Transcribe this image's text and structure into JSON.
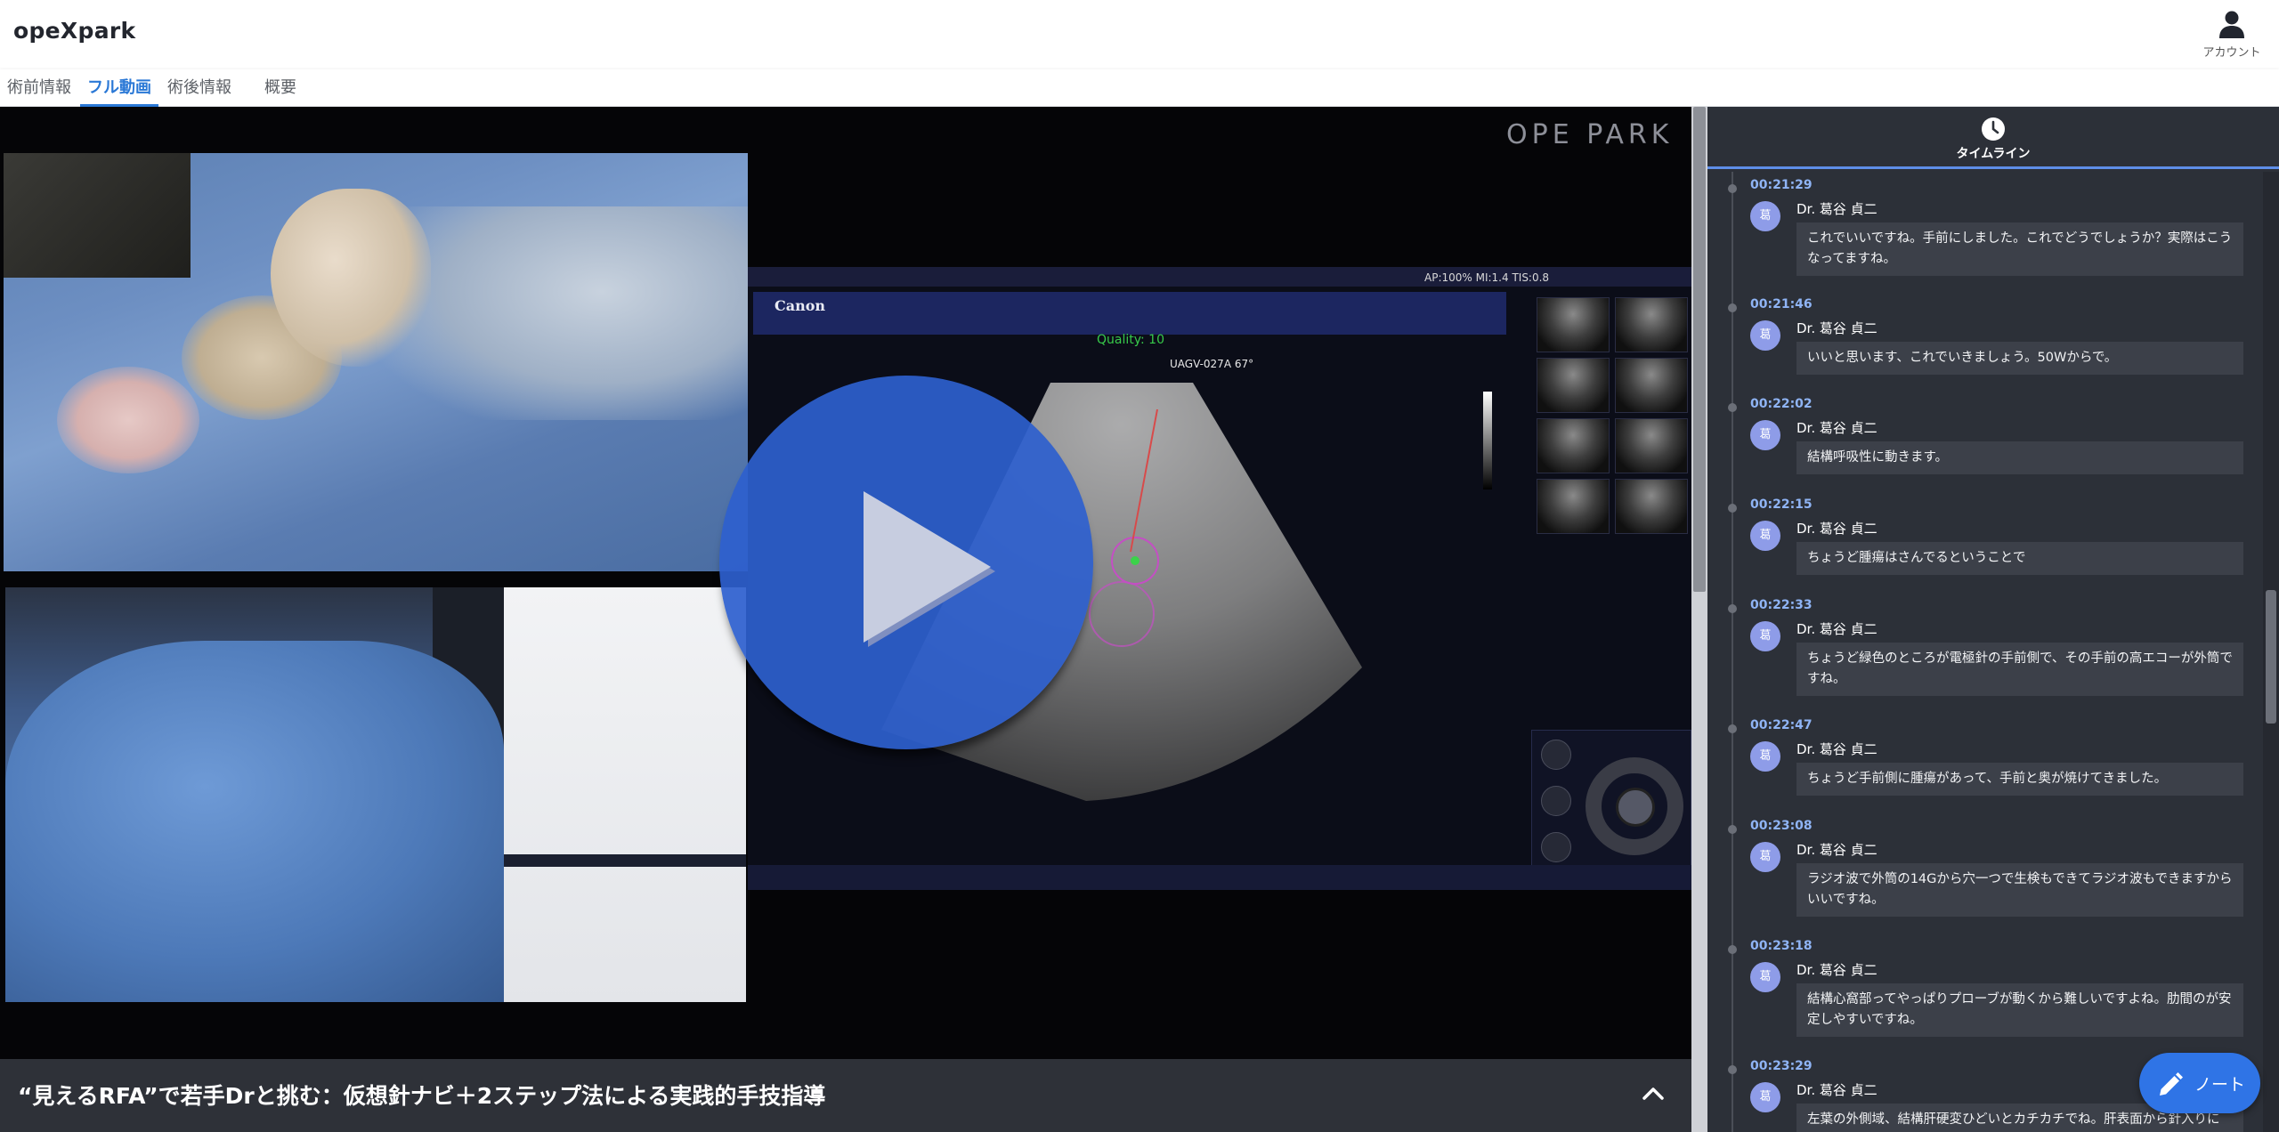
{
  "app": {
    "name": "opeXpark"
  },
  "header": {
    "account_label": "アカウント",
    "account_icon": "person-icon"
  },
  "tabs": [
    {
      "label": "術前情報",
      "active": false
    },
    {
      "label": "フル動画",
      "active": true
    },
    {
      "label": "術後情報",
      "active": false
    },
    {
      "label": "概要",
      "active": false
    }
  ],
  "video": {
    "watermark": "OPE PARK",
    "title": "“見えるRFA”で若手Drと挑む：仮想針ナビ＋2ステップ法による実践的手技指導",
    "ultrasound": {
      "brand": "Canon",
      "quality": "Quality: 10",
      "probe_label": "UAGV-027A 67°",
      "info": "AP:100%   MI:1.4   TIS:0.8"
    }
  },
  "timeline": {
    "header_label": "タイムライン",
    "entries": [
      {
        "time": "00:21:29",
        "avatar": "葛",
        "name": "Dr. 葛谷 貞二",
        "text": "これでいいですね。手前にしました。これでどうでしょうか？実際はこうなってますね。"
      },
      {
        "time": "00:21:46",
        "avatar": "葛",
        "name": "Dr. 葛谷 貞二",
        "text": "いいと思います、これでいきましょう。50Wからで。"
      },
      {
        "time": "00:22:02",
        "avatar": "葛",
        "name": "Dr. 葛谷 貞二",
        "text": "結構呼吸性に動きます。"
      },
      {
        "time": "00:22:15",
        "avatar": "葛",
        "name": "Dr. 葛谷 貞二",
        "text": "ちょうど腫瘍はさんでるということで"
      },
      {
        "time": "00:22:33",
        "avatar": "葛",
        "name": "Dr. 葛谷 貞二",
        "text": "ちょうど緑色のところが電極針の手前側で、その手前の高エコーが外筒ですね。"
      },
      {
        "time": "00:22:47",
        "avatar": "葛",
        "name": "Dr. 葛谷 貞二",
        "text": "ちょうど手前側に腫瘍があって、手前と奥が焼けてきました。"
      },
      {
        "time": "00:23:08",
        "avatar": "葛",
        "name": "Dr. 葛谷 貞二",
        "text": "ラジオ波で外筒の14Gから穴一つで生検もできてラジオ波もできますからいいですね。"
      },
      {
        "time": "00:23:18",
        "avatar": "葛",
        "name": "Dr. 葛谷 貞二",
        "text": "結構心窩部ってやっぱりプローブが動くから難しいですよね。肋間のが安定しやすいですね。"
      },
      {
        "time": "00:23:29",
        "avatar": "葛",
        "name": "Dr. 葛谷 貞二",
        "text": "左葉の外側域、結構肝硬変ひどいとカチカチでね。肝表面から針入りに"
      }
    ]
  },
  "note_button": {
    "label": "ノート",
    "icon": "pencil-icon"
  },
  "colors": {
    "accent": "#2a78d6",
    "play": "#2e60ce",
    "timeline_bg": "#2c3038",
    "time_text": "#8fb4f5",
    "note": "#2f74e6"
  }
}
